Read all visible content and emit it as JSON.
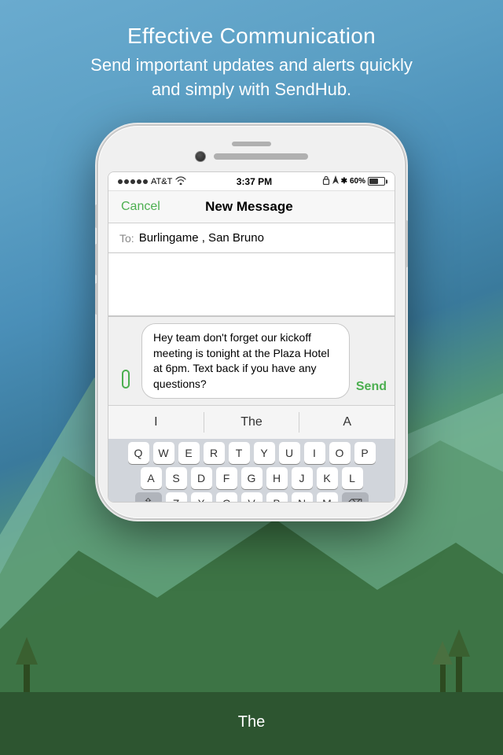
{
  "background": {
    "colors": {
      "sky_top": "#6aabcf",
      "sky_bottom": "#4a8fb8",
      "mountain_green": "#4a8a55",
      "mountain_dark": "#3a7040"
    }
  },
  "top_text": {
    "heading": "Effective Communication",
    "subheading": "Send important updates and alerts quickly\nand simply with SendHub."
  },
  "bottom_text": {
    "word": "The"
  },
  "phone": {
    "status_bar": {
      "carrier": "AT&T",
      "signal": "●●●●●",
      "wifi": "wifi",
      "time": "3:37 PM",
      "battery_percent": "60%",
      "lock_icon": "🔒",
      "location_icon": "➤",
      "bluetooth_icon": "✱"
    },
    "nav_bar": {
      "cancel_label": "Cancel",
      "title": "New Message",
      "send_label": "Send"
    },
    "to_field": {
      "label": "To:",
      "value": "Burlingame , San Bruno"
    },
    "message_text": "Hey team don't forget our kickoff meeting is tonight at the Plaza Hotel at 6pm. Text back if you have any questions?",
    "attach_icon": "📎",
    "autocomplete": {
      "items": [
        "I",
        "The",
        "A"
      ]
    },
    "keyboard_rows": [
      [
        "Q",
        "W",
        "E",
        "R",
        "T",
        "Y",
        "U",
        "I",
        "O",
        "P"
      ],
      [
        "A",
        "S",
        "D",
        "F",
        "G",
        "H",
        "J",
        "K",
        "L"
      ],
      [
        "⇧",
        "Z",
        "X",
        "C",
        "V",
        "B",
        "N",
        "M",
        "⌫"
      ]
    ]
  }
}
